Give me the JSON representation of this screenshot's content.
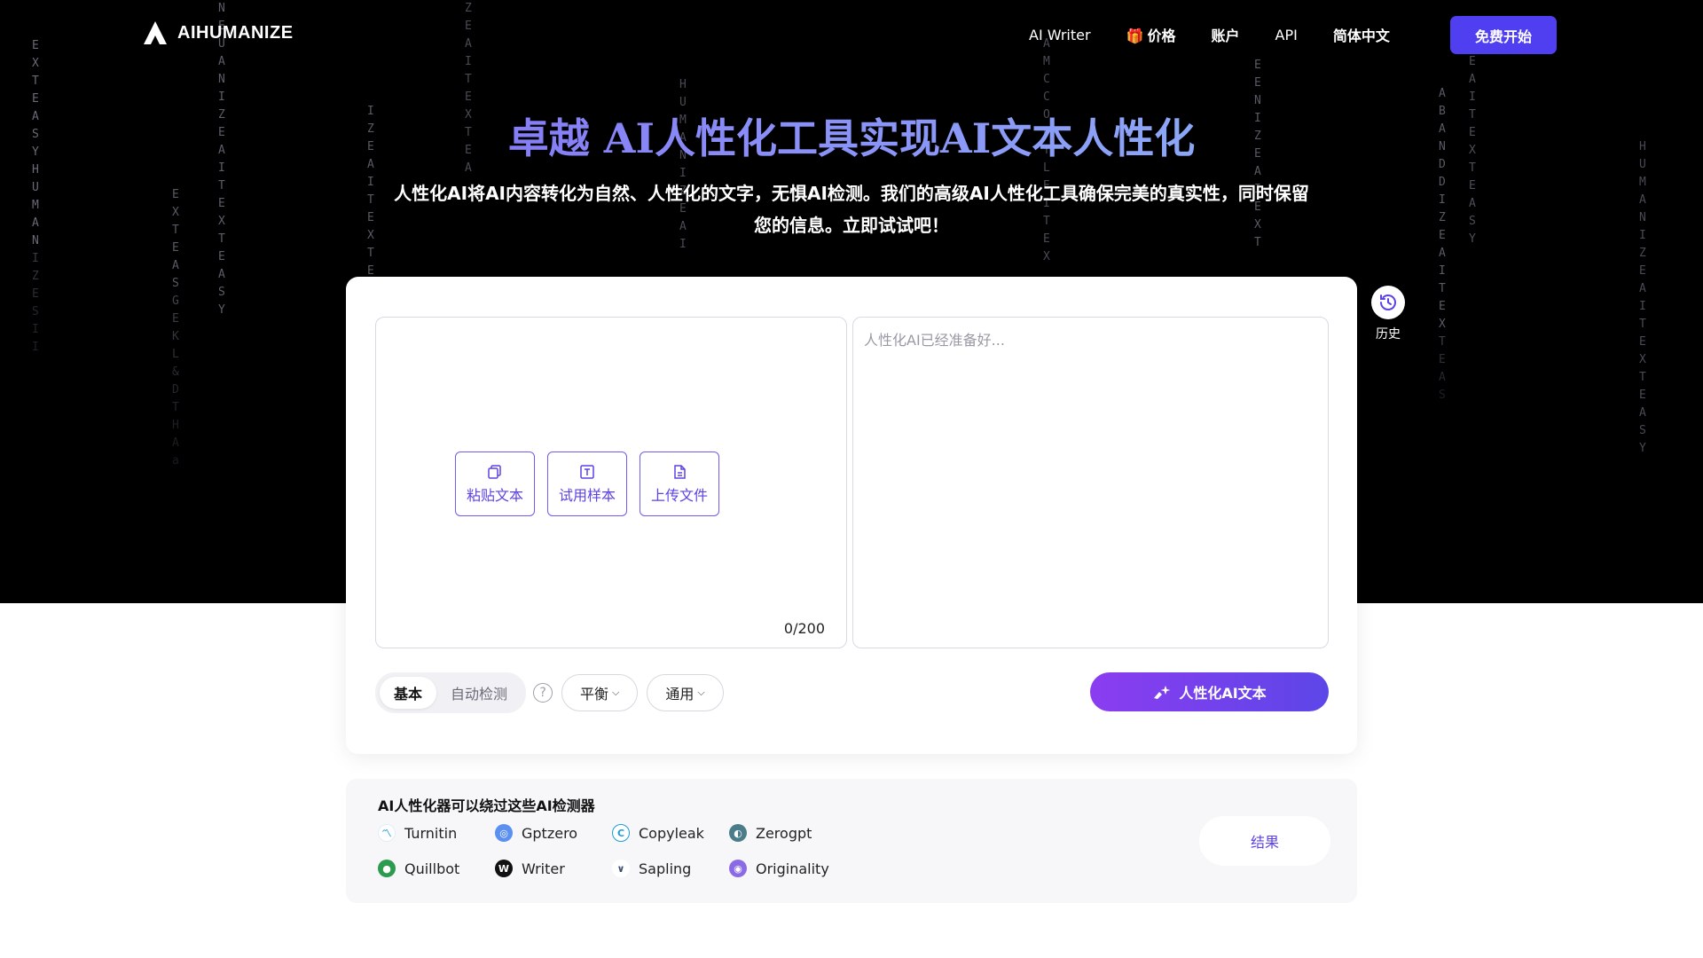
{
  "nav": {
    "logo_text": "AIHUMANIZE",
    "links": [
      {
        "label": "AI Writer",
        "icon": ""
      },
      {
        "label": "价格",
        "icon": "gift-icon"
      },
      {
        "label": "账户",
        "icon": ""
      },
      {
        "label": "API",
        "icon": ""
      },
      {
        "label": "简体中文",
        "icon": ""
      }
    ],
    "cta_label": "免费开始"
  },
  "hero": {
    "title": "卓越 AI人性化工具实现AI文本人性化",
    "subtitle_line1": "人性化AI将AI内容转化为自然、人性化的文字，无惧AI检测。我们的高级AI人性化工具确保完美的真实性，同时保留",
    "subtitle_line2": "您的信息。立即试试吧！"
  },
  "editor": {
    "input_counter": "0/200",
    "actions": [
      {
        "label": "粘贴文本",
        "icon": "paste-icon"
      },
      {
        "label": "试用样本",
        "icon": "text-sample-icon"
      },
      {
        "label": "上传文件",
        "icon": "file-upload-icon"
      }
    ],
    "output_placeholder": "人性化AI已经准备好..."
  },
  "controls": {
    "mode_basic": "基本",
    "mode_auto": "自动检测",
    "help_glyph": "?",
    "strength": "平衡",
    "purpose": "通用",
    "humanize_label": "人性化AI文本"
  },
  "history": {
    "label": "历史"
  },
  "detectors": {
    "title": "AI人性化器可以绕过这些AI检测器",
    "items": [
      {
        "name": "Turnitin",
        "color": "#2aa3d8"
      },
      {
        "name": "Gptzero",
        "color": "#5b8ff0"
      },
      {
        "name": "Copyleak",
        "color": "#1e9bd7"
      },
      {
        "name": "Zerogpt",
        "color": "#4a7c8a"
      },
      {
        "name": "Quillbot",
        "color": "#2c9b4f"
      },
      {
        "name": "Writer",
        "color": "#111111"
      },
      {
        "name": "Sapling",
        "color": "#3b4b6b"
      },
      {
        "name": "Originality",
        "color": "#8b6ae6"
      }
    ],
    "result_label": "结果"
  },
  "colors": {
    "accent": "#4f3ff0",
    "gradient_start": "#8b3df0",
    "gradient_end": "#5c46e8"
  }
}
